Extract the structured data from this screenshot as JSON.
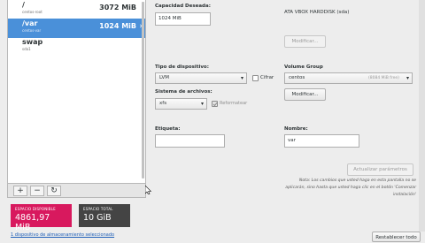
{
  "mount_points": [
    {
      "name": "/",
      "sub": "centos-root",
      "size": "3072 MiB",
      "selected": false
    },
    {
      "name": "/var",
      "sub": "centos-var",
      "size": "1024 MiB",
      "selected": true
    },
    {
      "name": "swap",
      "sub": "sda1",
      "size": "",
      "selected": false
    }
  ],
  "toolbar": {
    "add": "+",
    "remove": "−",
    "refresh": "↻"
  },
  "space": {
    "available_label": "ESPACIO DISPONIBLE",
    "available_value": "4861,97 MiB",
    "total_label": "ESPACIO TOTAL",
    "total_value": "10 GiB"
  },
  "storage_link": "1 dispositivo de almacenamiento seleccionado",
  "form": {
    "capacity_label": "Capacidad Deseada:",
    "capacity_value": "1024 MiB",
    "device_info": "ATA VBOX HARDDISK (sda)",
    "modify_top": "Modificar...",
    "device_type_label": "Tipo de dispositivo:",
    "device_type_value": "LVM",
    "encrypt_label": "Cifrar",
    "filesystem_label": "Sistema de archivos:",
    "filesystem_value": "xfs",
    "reformat_label": "Reformatear",
    "volume_group_label": "Volume Group",
    "volume_group_value": "centos",
    "volume_group_free": "(8084 MiB free)",
    "modify_vg": "Modificar...",
    "tag_label": "Etiqueta:",
    "tag_value": "",
    "name_label": "Nombre:",
    "name_value": "var",
    "update_button": "Actualizar parámetros",
    "note": "Nota: Los cambios que usted haga en esta pantalla no se aplicarán, sino hasta que usted haga clic en el botón 'Comenzar instalación'",
    "reset_button": "Restablecer todo"
  },
  "colors": {
    "selected": "#4a90d9",
    "available": "#d8195e",
    "total": "#444444"
  }
}
